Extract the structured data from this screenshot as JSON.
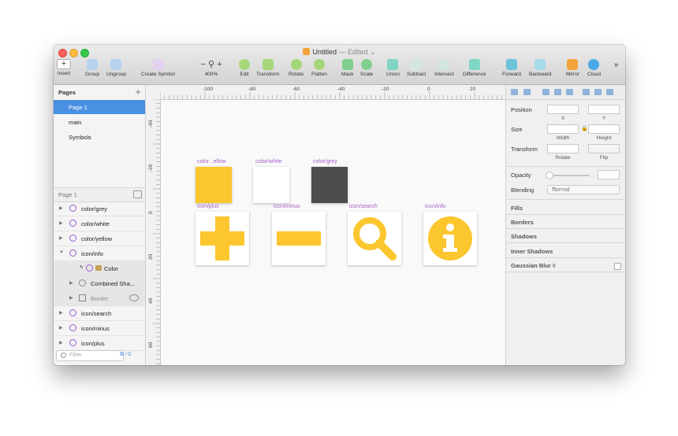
{
  "window": {
    "title": "Untitled",
    "edited": "— Edited ⌄"
  },
  "toolbar": {
    "insert": "Insert",
    "group": "Group",
    "ungroup": "Ungroup",
    "create_symbol": "Create Symbol",
    "zoom": "400%",
    "edit": "Edit",
    "transform": "Transform",
    "rotate": "Rotate",
    "flatten": "Flatten",
    "mask": "Mask",
    "scale": "Scale",
    "union": "Union",
    "subtract": "Subtract",
    "intersect": "Intersect",
    "difference": "Difference",
    "forward": "Forward",
    "backward": "Backward",
    "mirror": "Mirror",
    "cloud": "Cloud",
    "overflow": "»"
  },
  "sidebar": {
    "pages_title": "Pages",
    "pages": [
      "Page 1",
      "main",
      "Symbols"
    ],
    "current_page": "Page 1",
    "layers": [
      {
        "name": "color/grey"
      },
      {
        "name": "color/white"
      },
      {
        "name": "color/yellow"
      },
      {
        "name": "icon/info"
      },
      {
        "name": "Color"
      },
      {
        "name": "Combined Sha..."
      },
      {
        "name": "Border"
      },
      {
        "name": "icon/search"
      },
      {
        "name": "icon/minus"
      },
      {
        "name": "icon/plus"
      }
    ],
    "filter_placeholder": "Filter",
    "filter_count": "0"
  },
  "rulers": {
    "top": [
      "-100",
      "-80",
      "-60",
      "-40",
      "-20",
      "0",
      "20"
    ],
    "left": [
      "-40",
      "-20",
      "0",
      "20",
      "40",
      "60"
    ]
  },
  "canvas": {
    "swatches": [
      {
        "label": "color...ellow",
        "color": "#fcc62e"
      },
      {
        "label": "color/white",
        "color": "#ffffff"
      },
      {
        "label": "color/grey",
        "color": "#4d4d4d"
      }
    ],
    "icons": [
      {
        "label": "icon/plus",
        "icon": "plus-icon"
      },
      {
        "label": "icon/minus",
        "icon": "minus-icon"
      },
      {
        "label": "icon/search",
        "icon": "search-icon"
      },
      {
        "label": "icon/info",
        "icon": "info-icon"
      }
    ],
    "accent": "#fcc62e"
  },
  "inspector": {
    "position": "Position",
    "x": "X",
    "y": "Y",
    "size": "Size",
    "width": "Width",
    "height": "Height",
    "transform": "Transform",
    "rotate": "Rotate",
    "flip": "Flip",
    "opacity": "Opacity",
    "blending": "Blending",
    "blending_value": "Normal",
    "fills": "Fills",
    "borders": "Borders",
    "shadows": "Shadows",
    "inner_shadows": "Inner Shadows",
    "gaussian_blur": "Gaussian Blur ◊"
  }
}
